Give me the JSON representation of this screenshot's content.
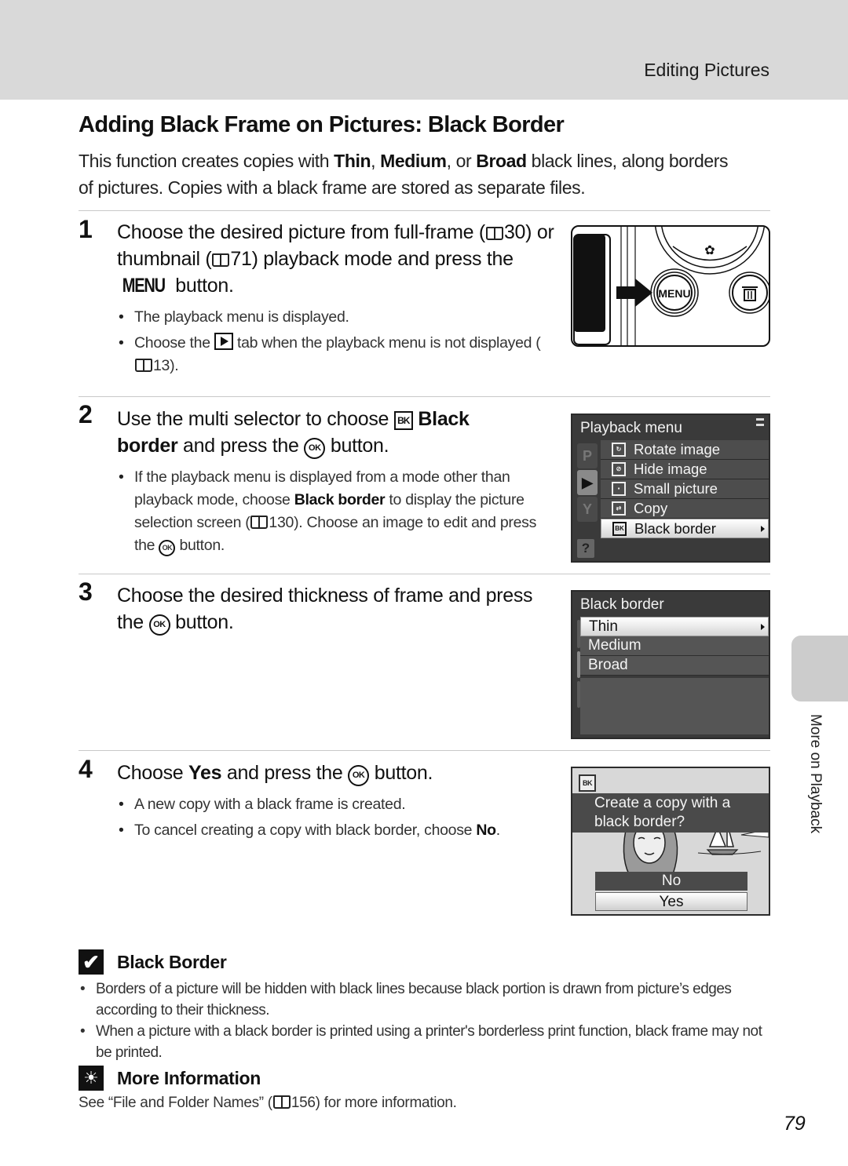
{
  "header": {
    "section_label": "Editing Pictures"
  },
  "page_title": "Adding Black Frame on Pictures: Black Border",
  "intro": {
    "part1": "This function creates copies with ",
    "thin": "Thin",
    "comma1": ", ",
    "medium": "Medium",
    "comma2": ", or ",
    "broad": "Broad",
    "part2": " black lines, along borders of pictures. Copies with a black frame are stored as separate files."
  },
  "steps": [
    {
      "number": "1",
      "head_a": "Choose the desired picture from full-frame (",
      "ref_a": "30",
      "head_b": ") or thumbnail (",
      "ref_b": "71",
      "head_c": ") playback mode and press the ",
      "menu_word": "MENU",
      "head_d": " button.",
      "bullets": [
        {
          "text": "The playback menu is displayed."
        },
        {
          "text_a": "Choose the ",
          "text_b": " tab when the playback menu is not displayed (",
          "ref": "13",
          "text_c": ")."
        }
      ]
    },
    {
      "number": "2",
      "head_a": "Use the multi selector to choose ",
      "bk_icon": "BK",
      "head_bold_a": " Black",
      "head_bold_b": "border",
      "head_b": " and press the ",
      "ok_icon": "OK",
      "head_c": " button.",
      "bullets": [
        {
          "text_a": "If the playback menu is displayed from a mode other than playback mode, choose ",
          "bold": "Black border",
          "text_b": " to display the picture selection screen (",
          "ref": "130",
          "text_c": "). Choose an image to edit and press the ",
          "ok_icon": "OK",
          "text_d": " button."
        }
      ]
    },
    {
      "number": "3",
      "head_a": "Choose the desired thickness of frame and press the ",
      "ok_icon": "OK",
      "head_b": " button."
    },
    {
      "number": "4",
      "head_a": "Choose ",
      "head_bold": "Yes",
      "head_b": " and press the ",
      "ok_icon": "OK",
      "head_c": " button.",
      "bullets": [
        {
          "text": "A new copy with a black frame is created."
        },
        {
          "text_a": "To cancel creating a copy with black border, choose ",
          "bold": "No",
          "text_b": "."
        }
      ]
    }
  ],
  "camera_illustration": {
    "menu_button_label": "MENU"
  },
  "playback_menu_screen": {
    "title": "Playback menu",
    "tabs": [
      {
        "label": "P",
        "icon": "shooting-tab-icon"
      },
      {
        "label": "▶",
        "icon": "playback-tab-icon",
        "active": true
      },
      {
        "label": "Y",
        "icon": "setup-tab-icon"
      }
    ],
    "help_label": "?",
    "items": [
      {
        "label": "Rotate image",
        "icon": "rotate-image-icon",
        "glyph": "↻"
      },
      {
        "label": "Hide image",
        "icon": "hide-image-icon",
        "glyph": "⊘"
      },
      {
        "label": "Small picture",
        "icon": "small-picture-icon",
        "glyph": "▪"
      },
      {
        "label": "Copy",
        "icon": "copy-icon",
        "glyph": "⇄"
      },
      {
        "label": "Black border",
        "icon": "black-border-icon",
        "glyph": "BK",
        "selected": true
      }
    ]
  },
  "black_border_screen": {
    "title": "Black border",
    "options": [
      {
        "label": "Thin",
        "selected": true
      },
      {
        "label": "Medium"
      },
      {
        "label": "Broad"
      }
    ]
  },
  "confirm_screen": {
    "badge": "BK",
    "prompt": "Create a copy with a black border?",
    "no_label": "No",
    "yes_label": "Yes",
    "selected": "Yes"
  },
  "side_tab": {
    "label": "More on Playback"
  },
  "notes": {
    "black_border": {
      "title": "Black Border",
      "icon": "✔",
      "bullets": [
        "Borders of a picture will be hidden with black lines because black portion is drawn from picture’s edges according to their thickness.",
        "When a picture with a black border is printed using a printer's borderless print function, black frame may not be printed."
      ]
    },
    "more_info": {
      "title": "More Information",
      "icon": "☀",
      "text_a": "See “File and Folder Names” (",
      "ref": "156",
      "text_b": ") for more information."
    }
  },
  "page_number": "79"
}
